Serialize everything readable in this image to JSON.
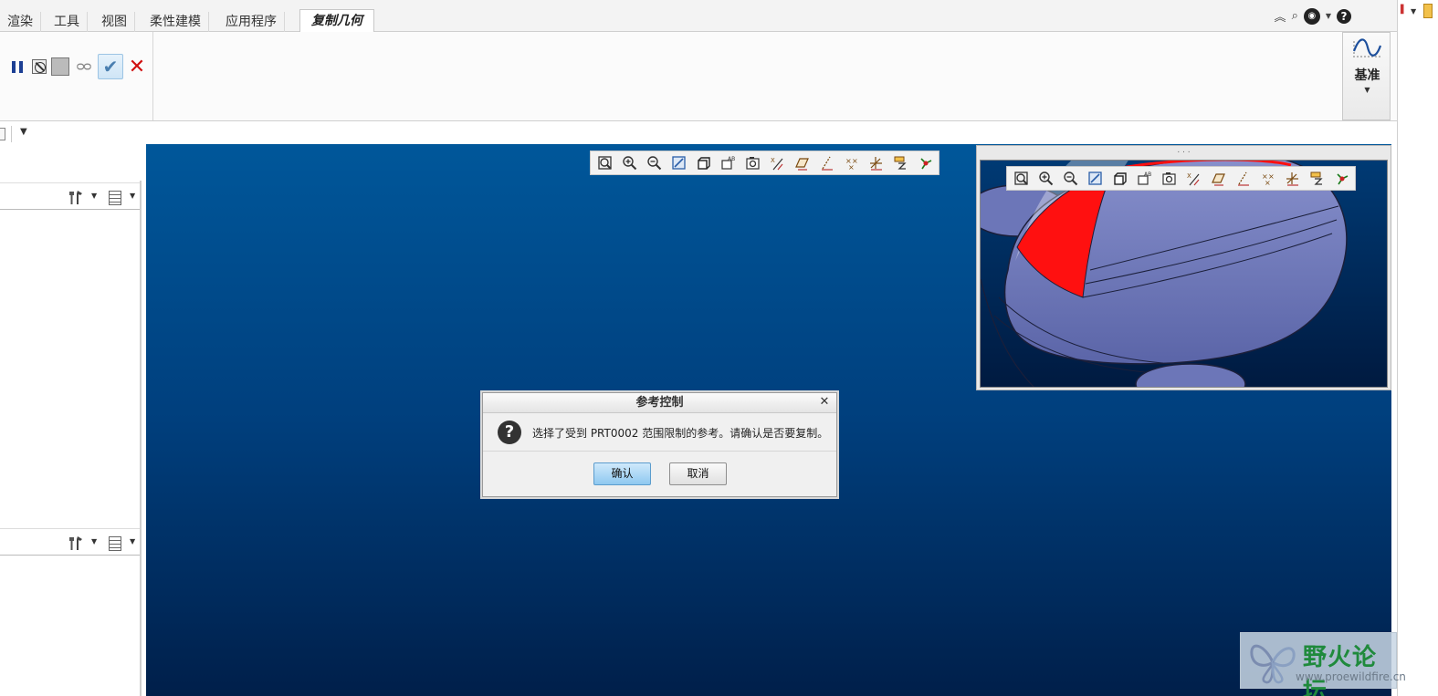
{
  "ribbon": {
    "tabs": [
      {
        "label": "渲染"
      },
      {
        "label": "工具"
      },
      {
        "label": "视图"
      },
      {
        "label": "柔性建模"
      },
      {
        "label": "应用程序"
      },
      {
        "label": "复制几何"
      }
    ],
    "active_tab": "复制几何",
    "datum_label": "基准"
  },
  "dialog": {
    "title": "参考控制",
    "message": "选择了受到 PRT0002 范围限制的参考。请确认是否要复制。",
    "confirm_label": "确认",
    "cancel_label": "取消"
  },
  "colors": {
    "graphics_top": "#00579a",
    "graphics_bottom": "#001f4a",
    "model_body": "#7480c0",
    "highlight_red": "#ff1010",
    "accept_blue": "#4a7fb0",
    "cancel_red": "#d01010"
  },
  "view_toolbar_icons": [
    "refit-icon",
    "zoom-in-icon",
    "zoom-out-icon",
    "repaint-icon",
    "display-style-icon",
    "saved-orientations-icon",
    "view-manager-icon",
    "datum-display-icon",
    "plane-display-icon",
    "axis-display-icon",
    "point-display-icon",
    "csys-display-icon",
    "annotation-display-icon",
    "spin-center-icon"
  ],
  "watermark": {
    "title": "野火论坛",
    "url": "www.proewildfire.cn"
  }
}
